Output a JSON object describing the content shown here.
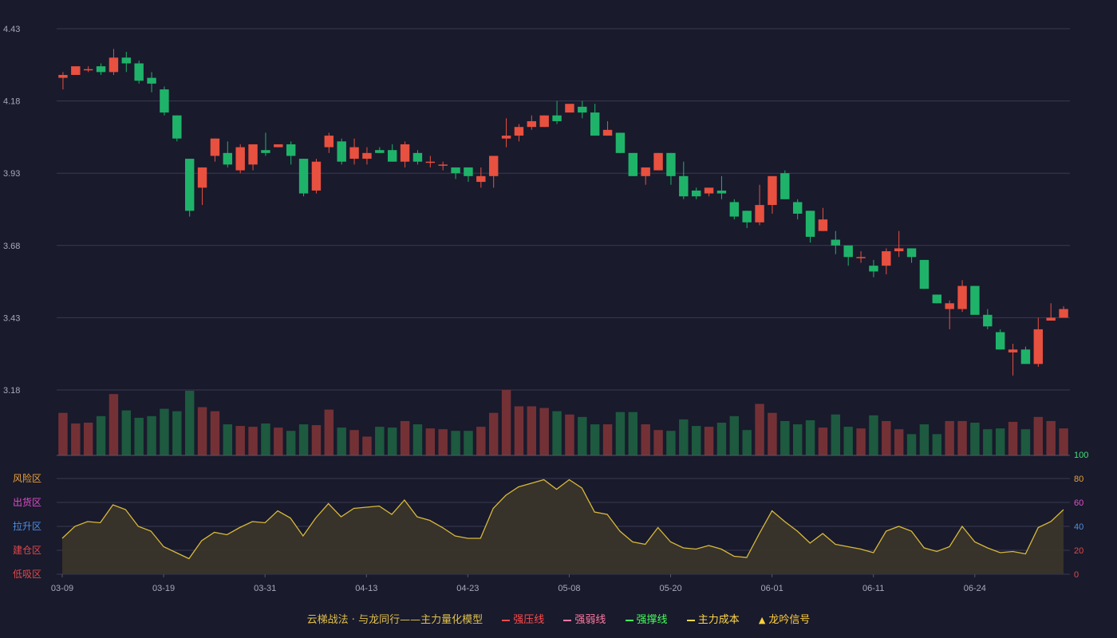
{
  "chart_data": {
    "type": "candlestick",
    "price_axis": {
      "ticks": [
        "4.43",
        "4.18",
        "3.93",
        "3.68",
        "3.43",
        "3.18"
      ],
      "min": 3.18,
      "max": 4.43
    },
    "x_ticks": [
      "03-09",
      "03-19",
      "03-31",
      "04-13",
      "04-23",
      "05-08",
      "05-20",
      "06-01",
      "06-11",
      "06-24"
    ],
    "x_tick_index": [
      0,
      8,
      16,
      24,
      32,
      40,
      48,
      56,
      64,
      72
    ],
    "ohlc": [
      [
        4.26,
        4.28,
        4.22,
        4.27
      ],
      [
        4.27,
        4.3,
        4.27,
        4.3
      ],
      [
        4.29,
        4.3,
        4.28,
        4.29
      ],
      [
        4.3,
        4.31,
        4.27,
        4.28
      ],
      [
        4.28,
        4.36,
        4.27,
        4.33
      ],
      [
        4.33,
        4.35,
        4.28,
        4.31
      ],
      [
        4.31,
        4.32,
        4.24,
        4.25
      ],
      [
        4.26,
        4.28,
        4.21,
        4.24
      ],
      [
        4.22,
        4.23,
        4.13,
        4.14
      ],
      [
        4.13,
        4.13,
        4.04,
        4.05
      ],
      [
        3.98,
        3.98,
        3.78,
        3.8
      ],
      [
        3.88,
        3.95,
        3.82,
        3.95
      ],
      [
        3.99,
        4.05,
        3.97,
        4.05
      ],
      [
        4.0,
        4.04,
        3.95,
        3.96
      ],
      [
        3.94,
        4.03,
        3.93,
        4.02
      ],
      [
        3.96,
        4.03,
        3.94,
        4.03
      ],
      [
        4.01,
        4.07,
        3.99,
        4.0
      ],
      [
        4.02,
        4.03,
        4.02,
        4.03
      ],
      [
        4.03,
        4.04,
        3.96,
        3.99
      ],
      [
        3.98,
        3.98,
        3.85,
        3.86
      ],
      [
        3.87,
        3.98,
        3.86,
        3.97
      ],
      [
        4.02,
        4.07,
        4.0,
        4.06
      ],
      [
        4.04,
        4.05,
        3.96,
        3.97
      ],
      [
        3.98,
        4.05,
        3.96,
        4.02
      ],
      [
        3.98,
        4.02,
        3.96,
        4.0
      ],
      [
        4.01,
        4.02,
        4.0,
        4.0
      ],
      [
        4.01,
        4.03,
        3.97,
        3.97
      ],
      [
        3.97,
        4.04,
        3.95,
        4.03
      ],
      [
        4.0,
        4.01,
        3.96,
        3.97
      ],
      [
        3.97,
        3.99,
        3.95,
        3.97
      ],
      [
        3.96,
        3.97,
        3.94,
        3.96
      ],
      [
        3.95,
        3.95,
        3.91,
        3.93
      ],
      [
        3.95,
        3.95,
        3.9,
        3.92
      ],
      [
        3.9,
        3.95,
        3.88,
        3.92
      ],
      [
        3.92,
        3.99,
        3.88,
        3.99
      ],
      [
        4.05,
        4.12,
        4.02,
        4.06
      ],
      [
        4.06,
        4.1,
        4.04,
        4.09
      ],
      [
        4.09,
        4.13,
        4.08,
        4.11
      ],
      [
        4.09,
        4.13,
        4.09,
        4.13
      ],
      [
        4.13,
        4.18,
        4.1,
        4.11
      ],
      [
        4.14,
        4.17,
        4.14,
        4.17
      ],
      [
        4.16,
        4.18,
        4.12,
        4.14
      ],
      [
        4.14,
        4.17,
        4.06,
        4.06
      ],
      [
        4.06,
        4.11,
        4.06,
        4.08
      ],
      [
        4.07,
        4.07,
        4.0,
        4.0
      ],
      [
        4.0,
        4.0,
        3.92,
        3.92
      ],
      [
        3.92,
        3.94,
        3.89,
        3.95
      ],
      [
        3.94,
        4.0,
        3.94,
        4.0
      ],
      [
        4.0,
        4.0,
        3.89,
        3.92
      ],
      [
        3.92,
        3.97,
        3.84,
        3.85
      ],
      [
        3.87,
        3.88,
        3.84,
        3.85
      ],
      [
        3.86,
        3.87,
        3.85,
        3.88
      ],
      [
        3.87,
        3.92,
        3.84,
        3.86
      ],
      [
        3.83,
        3.84,
        3.77,
        3.78
      ],
      [
        3.8,
        3.8,
        3.74,
        3.76
      ],
      [
        3.76,
        3.89,
        3.75,
        3.82
      ],
      [
        3.82,
        3.92,
        3.79,
        3.92
      ],
      [
        3.93,
        3.94,
        3.84,
        3.84
      ],
      [
        3.83,
        3.84,
        3.77,
        3.79
      ],
      [
        3.8,
        3.8,
        3.69,
        3.71
      ],
      [
        3.73,
        3.81,
        3.73,
        3.77
      ],
      [
        3.7,
        3.73,
        3.65,
        3.68
      ],
      [
        3.68,
        3.68,
        3.61,
        3.64
      ],
      [
        3.64,
        3.66,
        3.62,
        3.64
      ],
      [
        3.61,
        3.63,
        3.57,
        3.59
      ],
      [
        3.61,
        3.67,
        3.58,
        3.66
      ],
      [
        3.66,
        3.73,
        3.64,
        3.67
      ],
      [
        3.67,
        3.67,
        3.62,
        3.64
      ],
      [
        3.63,
        3.63,
        3.53,
        3.53
      ],
      [
        3.51,
        3.51,
        3.48,
        3.48
      ],
      [
        3.46,
        3.49,
        3.39,
        3.48
      ],
      [
        3.46,
        3.56,
        3.45,
        3.54
      ],
      [
        3.54,
        3.54,
        3.45,
        3.44
      ],
      [
        3.44,
        3.46,
        3.39,
        3.4
      ],
      [
        3.38,
        3.39,
        3.32,
        3.32
      ],
      [
        3.31,
        3.34,
        3.23,
        3.32
      ],
      [
        3.32,
        3.33,
        3.28,
        3.27
      ],
      [
        3.27,
        3.43,
        3.26,
        3.39
      ],
      [
        3.42,
        3.48,
        3.42,
        3.43
      ],
      [
        3.43,
        3.47,
        3.44,
        3.46
      ]
    ],
    "volume": [
      52,
      39,
      40,
      48,
      75,
      55,
      46,
      48,
      57,
      54,
      79,
      59,
      54,
      38,
      36,
      35,
      39,
      34,
      30,
      38,
      37,
      56,
      34,
      31,
      23,
      35,
      34,
      42,
      38,
      33,
      32,
      30,
      30,
      35,
      52,
      80,
      60,
      60,
      58,
      54,
      50,
      47,
      38,
      38,
      53,
      53,
      38,
      31,
      30,
      44,
      36,
      35,
      40,
      48,
      31,
      63,
      52,
      42,
      38,
      43,
      34,
      50,
      35,
      33,
      49,
      42,
      32,
      26,
      38,
      26,
      42,
      42,
      40,
      32,
      33,
      41,
      32,
      47,
      42,
      33
    ],
    "indicator": [
      30,
      40,
      44,
      43,
      58,
      54,
      40,
      36,
      23,
      18,
      13,
      28,
      35,
      33,
      39,
      44,
      43,
      53,
      47,
      32,
      47,
      59,
      48,
      55,
      56,
      57,
      50,
      62,
      48,
      45,
      39,
      32,
      30,
      30,
      55,
      66,
      73,
      76,
      79,
      71,
      79,
      72,
      52,
      50,
      36,
      27,
      25,
      39,
      27,
      22,
      21,
      24,
      21,
      15,
      14,
      34,
      53,
      44,
      36,
      26,
      34,
      25,
      23,
      21,
      18,
      36,
      40,
      36,
      22,
      19,
      23,
      40,
      27,
      22,
      18,
      19,
      17,
      39,
      44,
      54
    ],
    "indicator_axis": {
      "ticks": [
        "100",
        "80",
        "60",
        "40",
        "20",
        "0"
      ],
      "tick_colors": [
        "#3fe07a",
        "#e8a23c",
        "#e04dc9",
        "#4d8fe0",
        "#e0484a",
        "#e0484a"
      ]
    },
    "zones": [
      {
        "label": "风险区",
        "color": "#e8a23c"
      },
      {
        "label": "出货区",
        "color": "#e04dc9"
      },
      {
        "label": "拉升区",
        "color": "#4d8fe0"
      },
      {
        "label": "建仓区",
        "color": "#e0484a"
      },
      {
        "label": "低吸区",
        "color": "#e0484a"
      }
    ],
    "colors": {
      "up": "#e8503f",
      "down": "#1fb36a",
      "vol_up": "#733136",
      "vol_down": "#1d5a3f",
      "indicator_line": "#d8b93a",
      "grid": "#3a3b52",
      "axis_text": "#a8a9b8"
    }
  },
  "legend": {
    "title": "云梯战法 · 与龙同行——主力量化模型",
    "items": [
      {
        "label": "强压线",
        "color": "#ff4b4b",
        "style": "line"
      },
      {
        "label": "强弱线",
        "color": "#ff7aa2",
        "style": "dash"
      },
      {
        "label": "强撑线",
        "color": "#43ff59",
        "style": "line"
      },
      {
        "label": "主力成本",
        "color": "#ffd84a",
        "style": "dash"
      },
      {
        "label": "龙吟信号",
        "color": "#ffcf3a",
        "style": "tri"
      }
    ]
  }
}
